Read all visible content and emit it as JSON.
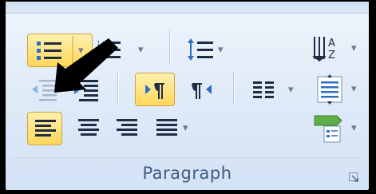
{
  "group_label": "Paragraph",
  "dropdown_glyph": "▾",
  "colors": {
    "ribbon_bg": "#dfeaf8",
    "active_bg": "#ffd75a",
    "active_border": "#d1a43a",
    "label_text": "#3e5a86",
    "icon_dark": "#1f2d44",
    "icon_blue": "#2d6fc4",
    "arrow": "#000000"
  },
  "buttons": [
    {
      "name": "bullets",
      "icon": "bullets-icon",
      "state": "active",
      "has_dropdown": true
    },
    {
      "name": "numbering",
      "icon": "numbering-icon",
      "state": "normal",
      "has_dropdown": true
    },
    {
      "name": "line-spacing",
      "icon": "line-spacing-icon",
      "state": "normal",
      "has_dropdown": true
    },
    {
      "name": "sort",
      "icon": "sort-icon",
      "state": "normal",
      "has_dropdown": true
    },
    {
      "name": "decrease-indent",
      "icon": "decrease-indent-icon",
      "state": "disabled",
      "has_dropdown": false
    },
    {
      "name": "increase-indent",
      "icon": "increase-indent-icon",
      "state": "normal",
      "has_dropdown": false
    },
    {
      "name": "left-to-right",
      "icon": "ltr-paragraph-icon",
      "state": "active",
      "has_dropdown": false
    },
    {
      "name": "right-to-left",
      "icon": "rtl-paragraph-icon",
      "state": "normal",
      "has_dropdown": false
    },
    {
      "name": "columns",
      "icon": "columns-icon",
      "state": "normal",
      "has_dropdown": true
    },
    {
      "name": "align-text",
      "icon": "align-text-icon",
      "state": "normal",
      "has_dropdown": true
    },
    {
      "name": "align-left",
      "icon": "align-left-icon",
      "state": "active",
      "has_dropdown": false
    },
    {
      "name": "center",
      "icon": "align-center-icon",
      "state": "normal",
      "has_dropdown": false
    },
    {
      "name": "align-right",
      "icon": "align-right-icon",
      "state": "normal",
      "has_dropdown": false
    },
    {
      "name": "justify",
      "icon": "justify-icon",
      "state": "normal",
      "has_dropdown": true
    },
    {
      "name": "convert-to-smartart",
      "icon": "smartart-icon",
      "state": "normal",
      "has_dropdown": true
    }
  ],
  "annotation": {
    "icon": "pointer-arrow-icon",
    "points_to": "decrease-indent"
  }
}
